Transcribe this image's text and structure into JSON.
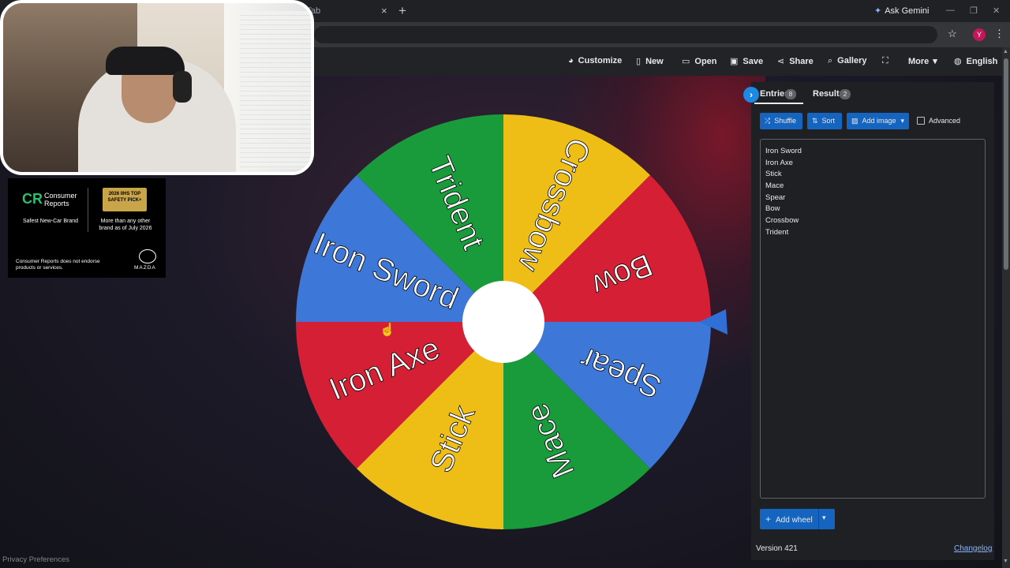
{
  "browser": {
    "tab_title": "y Tab",
    "tab_close": "×",
    "new_tab": "+",
    "tab_dropdown": "⌄",
    "ask_gemini": "Ask Gemini",
    "window_controls": [
      "—",
      "❐",
      "✕"
    ],
    "profile_initial": "Y"
  },
  "toolbar": {
    "items": [
      {
        "label": "Customize",
        "icon": "palette-icon"
      },
      {
        "label": "New",
        "icon": "new-file-icon"
      },
      {
        "label": "Open",
        "icon": "folder-open-icon"
      },
      {
        "label": "Save",
        "icon": "save-icon"
      },
      {
        "label": "Share",
        "icon": "share-icon"
      },
      {
        "label": "Gallery",
        "icon": "search-icon"
      },
      {
        "label": "",
        "icon": "fullscreen-icon"
      },
      {
        "label": "More",
        "icon": "chevron-down-icon"
      },
      {
        "label": "English",
        "icon": "globe-icon"
      }
    ]
  },
  "ad": {
    "cr_logo": "CR",
    "cr_name": "Consumer Reports",
    "iihs_badge": "2026 IIHS TOP SAFETY PICK+",
    "safest": "Safest New-Car Brand",
    "more_than": "More than any other brand as of July 2026",
    "disclaimer": "Consumer Reports does not endorse products or services.",
    "brand": "MAZDA"
  },
  "wheel": {
    "segments": [
      {
        "label": "Iron Sword",
        "color": "#3d78d8"
      },
      {
        "label": "Trident",
        "color": "#199a3b"
      },
      {
        "label": "Crossbow",
        "color": "#eebd16"
      },
      {
        "label": "Bow",
        "color": "#d41f35"
      },
      {
        "label": "Spear",
        "color": "#3d78d8"
      },
      {
        "label": "Mace",
        "color": "#199a3b"
      },
      {
        "label": "Stick",
        "color": "#eebd16"
      },
      {
        "label": "Iron Axe",
        "color": "#d41f35"
      }
    ],
    "pointer_color": "#2f6fd6"
  },
  "panel": {
    "tabs": [
      {
        "label": "Entries",
        "count": "8"
      },
      {
        "label": "Results",
        "count": "2"
      }
    ],
    "buttons": {
      "shuffle": "Shuffle",
      "sort": "Sort",
      "add_image": "Add image",
      "advanced": "Advanced"
    },
    "entries": [
      "Iron Sword",
      "Iron Axe",
      "Stick",
      "Mace",
      "Spear",
      "Bow",
      "Crossbow",
      "Trident"
    ],
    "add_wheel": "Add wheel",
    "version": "Version 421",
    "changelog": "Changelog"
  },
  "footer": {
    "privacy": "Privacy Preferences"
  }
}
